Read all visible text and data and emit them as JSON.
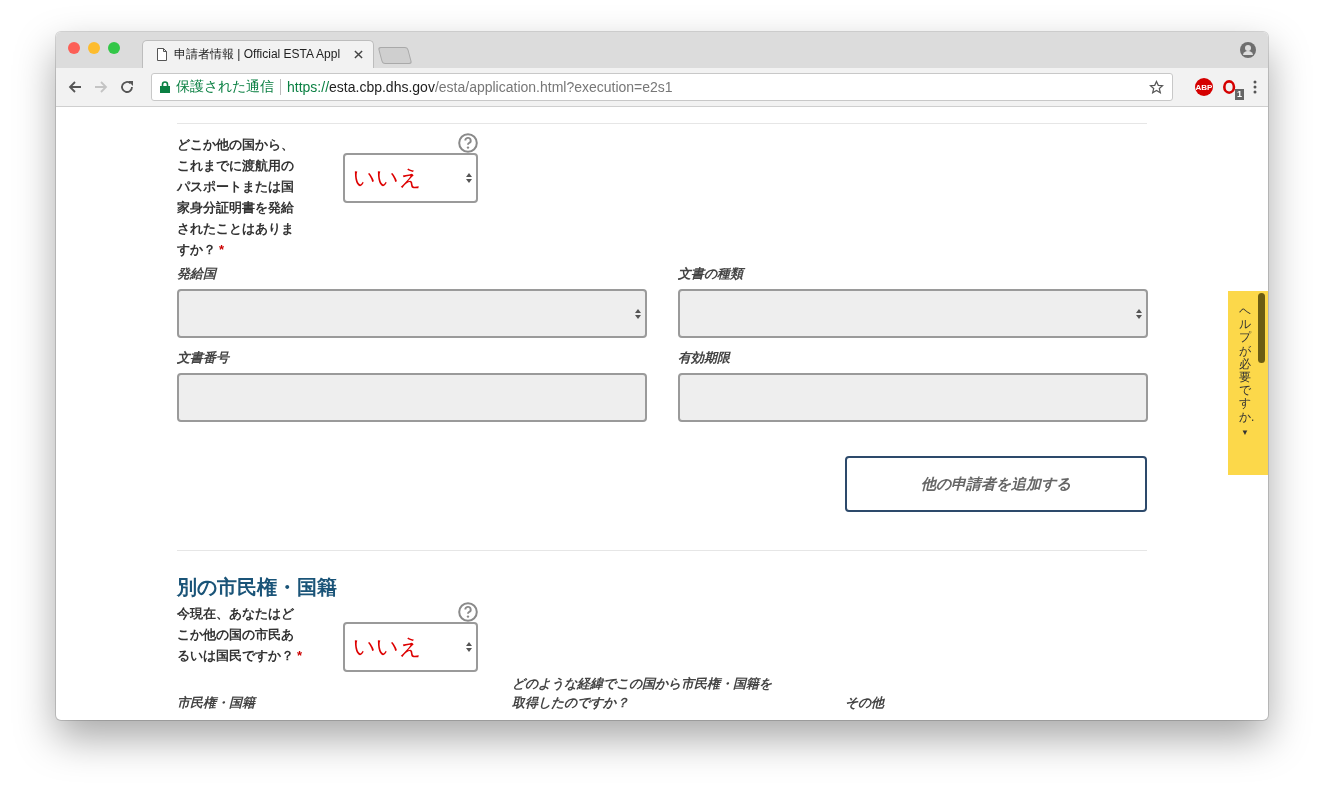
{
  "browser": {
    "tab_title": "申請者情報 | Official ESTA Appl",
    "url_secure": "保護された通信",
    "url_scheme": "https://",
    "url_host": "esta.cbp.dhs.gov",
    "url_path": "/esta/application.html?execution=e2s1",
    "extension_label": "ABP",
    "extension_badge": "1"
  },
  "help_tab": {
    "label": "ヘルプが必要ですか.",
    "arrow": "▼"
  },
  "question_1": {
    "label": "どこか他の国から、これまでに渡航用のパスポートまたは国家身分証明書を発給されたことはありますか？",
    "required_mark": "*",
    "value": "いいえ"
  },
  "document_fields": [
    {
      "label": "発給国",
      "kind": "select"
    },
    {
      "label": "文書の種類",
      "kind": "select"
    },
    {
      "label": "文書番号",
      "kind": "input"
    },
    {
      "label": "有効期限",
      "kind": "input"
    }
  ],
  "add_button": "他の申請者を追加する",
  "section_heading": "別の市民権・国籍",
  "question_2": {
    "label": "今現在、あなたはどこか他の国の市民あるいは国民ですか？",
    "required_mark": "*",
    "value": "いいえ"
  },
  "citizenship_columns": [
    "市民権・国籍",
    "どのような経緯でこの国から市民権・国籍を取得したのですか？",
    "その他"
  ]
}
